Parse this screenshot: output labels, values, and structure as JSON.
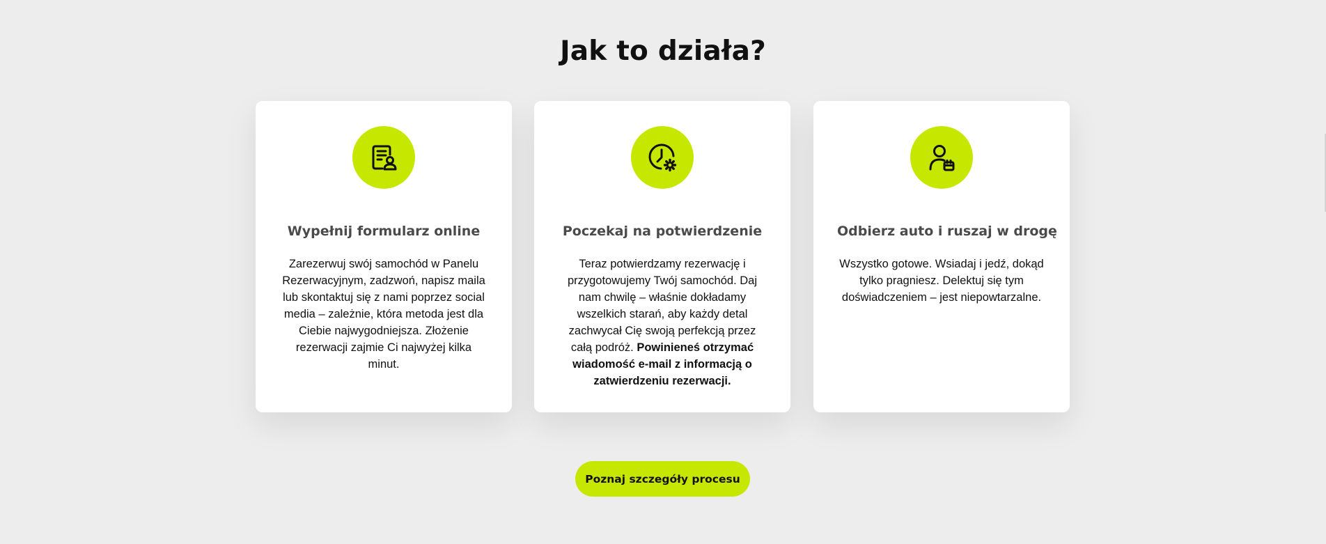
{
  "section": {
    "title": "Jak to działa?"
  },
  "steps": [
    {
      "icon": "form-document-user-icon",
      "title": "Wypełnij formularz online",
      "text": "Zarezerwuj swój samochód w Panelu Rezerwacyjnym, zadzwoń, napisz maila lub skontaktuj się z nami poprzez social media – zależnie, która metoda jest dla Ciebie najwygodniejsza. Złożenie rezerwacji zajmie Ci najwyżej kilka minut."
    },
    {
      "icon": "clock-gear-icon",
      "title": "Poczekaj na potwierdzenie",
      "text": "Teraz potwierdzamy rezerwację i przygotowujemy Twój samochód. Daj nam chwilę – właśnie dokładamy wszelkich starań, aby każdy detal zachwycał Cię swoją perfekcją przez całą podróż.",
      "text_bold": "Powinieneś otrzymać wiadomość e-mail z informacją o zatwierdzeniu rezerwacji."
    },
    {
      "icon": "user-calendar-icon",
      "title": "Odbierz auto i ruszaj w drogę",
      "text": "Wszystko gotowe. Wsiadaj i jedź, dokąd tylko pragniesz. Delektuj się tym doświadczeniem – jest niepowtarzalne."
    }
  ],
  "cta": {
    "label": "Poznaj szczegóły procesu"
  },
  "colors": {
    "accent": "#c6e800",
    "background": "#ededed",
    "card": "#ffffff",
    "title_text": "#111111",
    "card_title_text": "#4a4a4a"
  }
}
